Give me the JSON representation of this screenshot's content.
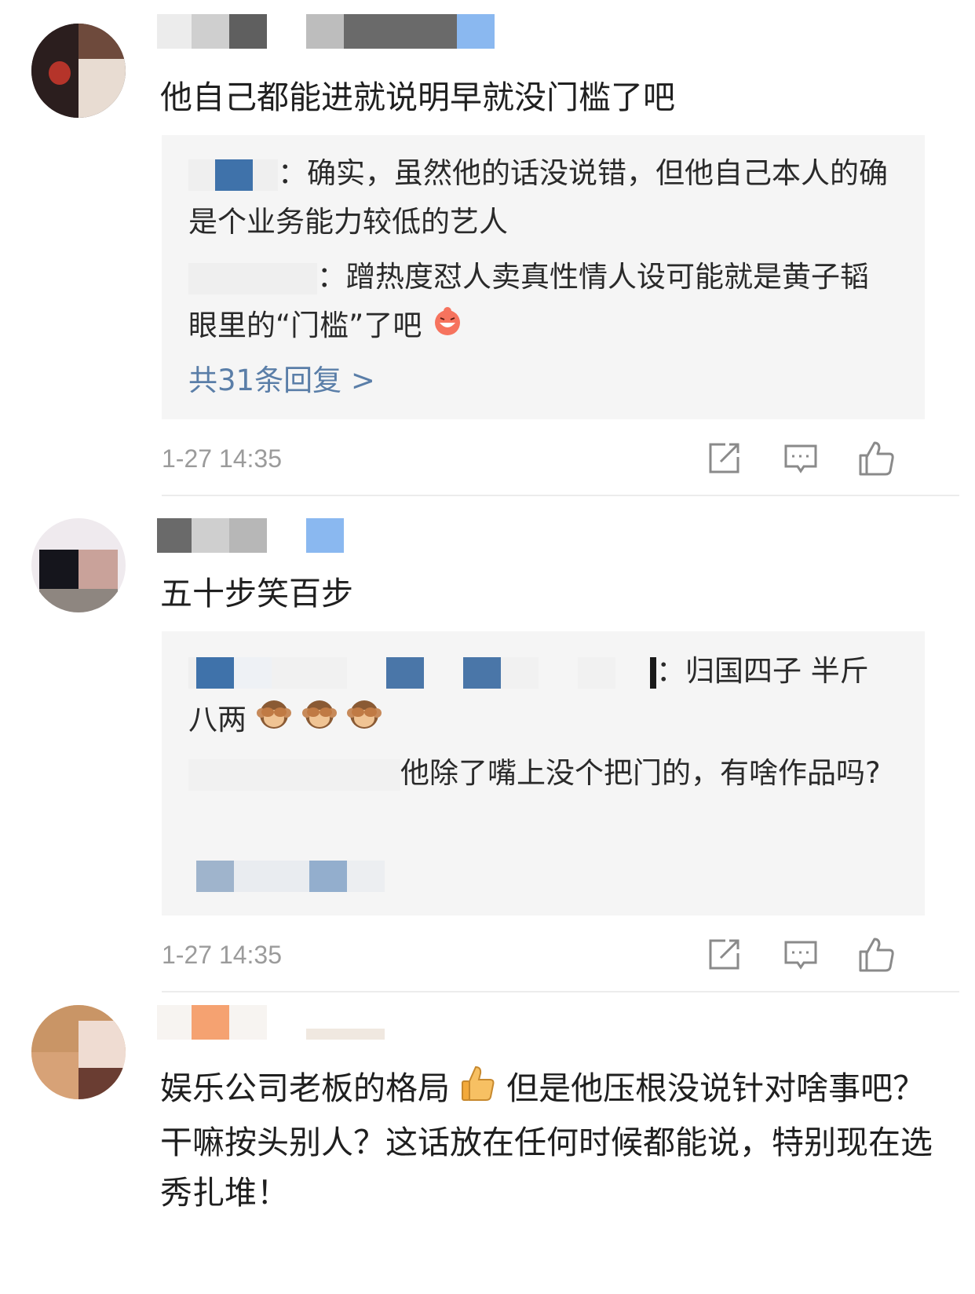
{
  "comments": [
    {
      "text": "他自己都能进就说明早就没门槛了吧",
      "replies": [
        {
          "sep": "：",
          "text": "确实，虽然他的话没说错，但他自己本人的确是个业务能力较低的艺人"
        },
        {
          "sep": "：",
          "text": "蹭热度怼人卖真性情人设可能就是黄子韬眼里的“门槛”了吧"
        }
      ],
      "more_replies": "共31条回复 >",
      "time": "1-27 14:35"
    },
    {
      "text": "五十步笑百步",
      "replies": [
        {
          "sep": "：",
          "text": "归国四子 半斤八两"
        },
        {
          "sep": "",
          "text": "他除了嘴上没个把门的，有啥作品吗?"
        }
      ],
      "time": "1-27 14:35"
    },
    {
      "text_a": "娱乐公司老板的格局",
      "text_b": "但是他压根没说针对啥事吧？干嘛按头别人？这话放在任何时候都能说，特别现在选秀扎堆！"
    }
  ],
  "icons": [
    "repost-icon",
    "comment-icon",
    "like-icon",
    "laugh-emoji-icon",
    "see-no-evil-monkey-emoji-icon",
    "thumbs-up-emoji-icon"
  ],
  "colors": {
    "link": "#5a7ea8",
    "reply_bg": "#f5f5f5",
    "time": "#9b9b9b",
    "divider": "#ececec"
  }
}
